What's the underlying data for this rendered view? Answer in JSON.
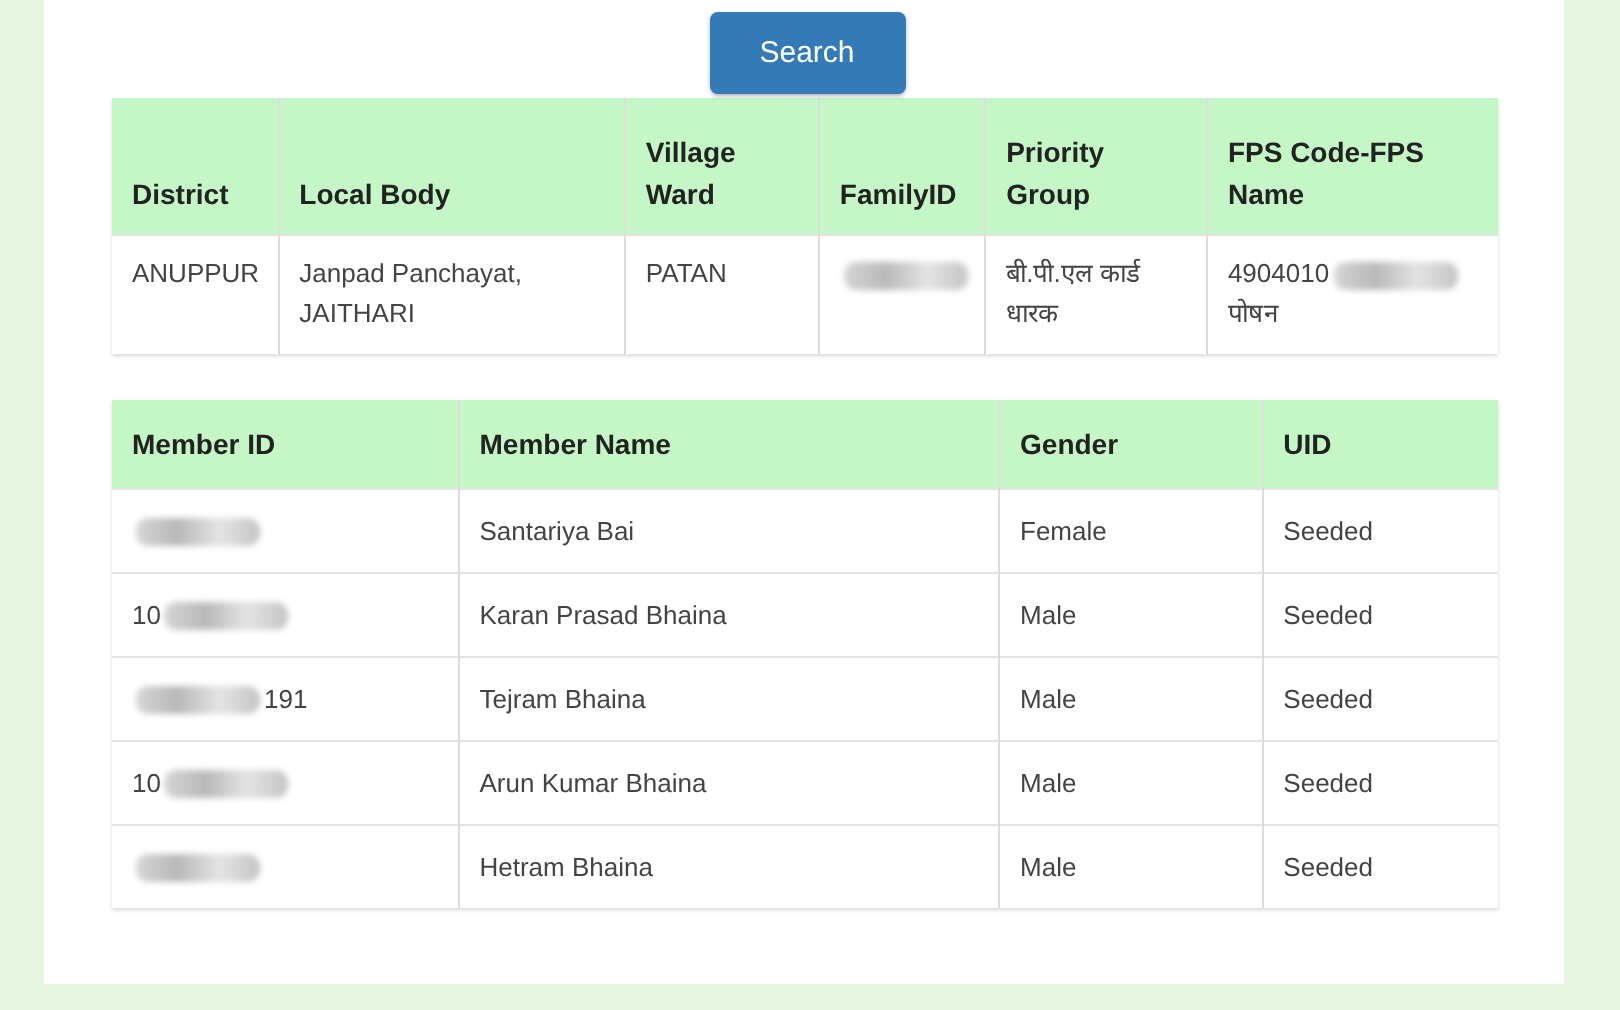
{
  "search_button": {
    "label": "Search"
  },
  "family_table": {
    "columns": [
      "District",
      "Local Body",
      "Village Ward",
      "FamilyID",
      "Priority Group",
      "FPS Code-FPS Name"
    ],
    "rows": [
      [
        [
          {
            "kind": "text",
            "text": "ANUPPUR"
          }
        ],
        [
          {
            "kind": "text",
            "text": "Janpad Panchayat, JAITHARI"
          }
        ],
        [
          {
            "kind": "text",
            "text": "PATAN"
          }
        ],
        [
          {
            "kind": "smudge"
          }
        ],
        [
          {
            "kind": "text",
            "text": "बी.पी.एल कार्ड धारक"
          }
        ],
        [
          {
            "kind": "text",
            "text": "4904010"
          },
          {
            "kind": "smudge"
          },
          {
            "kind": "text",
            "text": "पोषन"
          }
        ]
      ]
    ]
  },
  "member_table": {
    "columns": [
      "Member ID",
      "Member Name",
      "Gender",
      "UID"
    ],
    "rows": [
      [
        [
          {
            "kind": "smudge"
          }
        ],
        [
          {
            "kind": "text",
            "text": "Santariya Bai"
          }
        ],
        [
          {
            "kind": "text",
            "text": "Female"
          }
        ],
        [
          {
            "kind": "text",
            "text": "Seeded"
          }
        ]
      ],
      [
        [
          {
            "kind": "text",
            "text": "10"
          },
          {
            "kind": "smudge"
          }
        ],
        [
          {
            "kind": "text",
            "text": "Karan Prasad Bhaina"
          }
        ],
        [
          {
            "kind": "text",
            "text": "Male"
          }
        ],
        [
          {
            "kind": "text",
            "text": "Seeded"
          }
        ]
      ],
      [
        [
          {
            "kind": "smudge"
          },
          {
            "kind": "text",
            "text": "191"
          }
        ],
        [
          {
            "kind": "text",
            "text": "Tejram Bhaina"
          }
        ],
        [
          {
            "kind": "text",
            "text": "Male"
          }
        ],
        [
          {
            "kind": "text",
            "text": "Seeded"
          }
        ]
      ],
      [
        [
          {
            "kind": "text",
            "text": "10"
          },
          {
            "kind": "smudge"
          }
        ],
        [
          {
            "kind": "text",
            "text": "Arun Kumar Bhaina"
          }
        ],
        [
          {
            "kind": "text",
            "text": "Male"
          }
        ],
        [
          {
            "kind": "text",
            "text": "Seeded"
          }
        ]
      ],
      [
        [
          {
            "kind": "smudge"
          }
        ],
        [
          {
            "kind": "text",
            "text": "Hetram Bhaina"
          }
        ],
        [
          {
            "kind": "text",
            "text": "Male"
          }
        ],
        [
          {
            "kind": "text",
            "text": "Seeded"
          }
        ]
      ]
    ]
  }
}
